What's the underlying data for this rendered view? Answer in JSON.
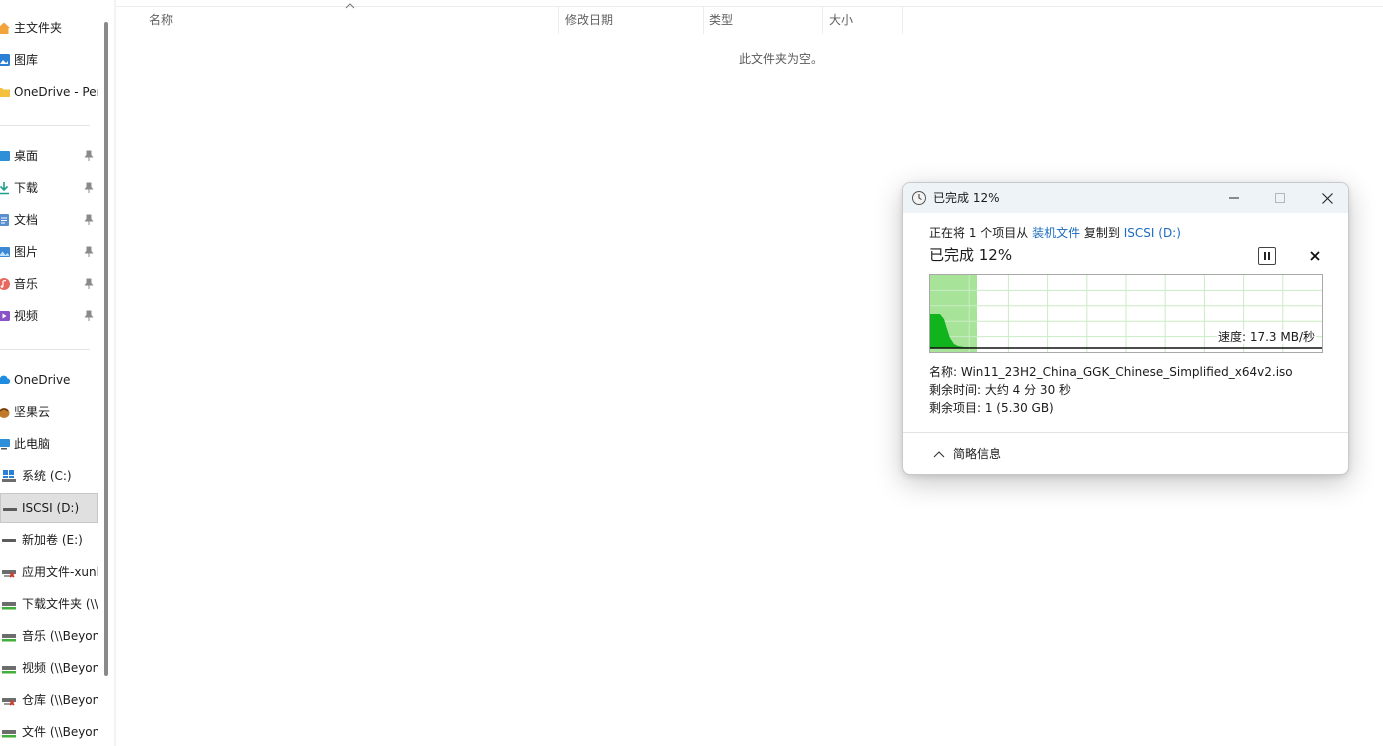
{
  "sidebar": {
    "items": [
      {
        "label": "主文件夹",
        "icon": "home-icon",
        "pinned": false
      },
      {
        "label": "图库",
        "icon": "gallery-icon",
        "pinned": false
      },
      {
        "label": "OneDrive - Personal",
        "icon": "folder-icon",
        "pinned": false
      },
      {
        "label": "桌面",
        "icon": "desktop-icon",
        "pinned": true
      },
      {
        "label": "下载",
        "icon": "download-icon",
        "pinned": true
      },
      {
        "label": "文档",
        "icon": "document-icon",
        "pinned": true
      },
      {
        "label": "图片",
        "icon": "pictures-icon",
        "pinned": true
      },
      {
        "label": "音乐",
        "icon": "music-icon",
        "pinned": true
      },
      {
        "label": "视频",
        "icon": "video-icon",
        "pinned": true
      },
      {
        "label": "OneDrive",
        "icon": "cloud-icon",
        "pinned": false
      },
      {
        "label": "坚果云",
        "icon": "nutstore-icon",
        "pinned": false
      },
      {
        "label": "此电脑",
        "icon": "computer-icon",
        "pinned": false
      },
      {
        "label": "系统 (C:)",
        "icon": "windows-drive-icon",
        "pinned": false
      },
      {
        "label": "ISCSI (D:)",
        "icon": "drive-icon",
        "pinned": false,
        "selected": true
      },
      {
        "label": "新加卷 (E:)",
        "icon": "drive-icon",
        "pinned": false
      },
      {
        "label": "应用文件-xunlei",
        "icon": "network-drive-disconnected-icon",
        "pinned": false
      },
      {
        "label": "下载文件夹 (\\\\Beyond",
        "icon": "network-drive-icon",
        "pinned": false
      },
      {
        "label": "音乐 (\\\\Beyond",
        "icon": "network-drive-icon",
        "pinned": false
      },
      {
        "label": "视频 (\\\\Beyond",
        "icon": "network-drive-icon",
        "pinned": false
      },
      {
        "label": "仓库 (\\\\Beyond",
        "icon": "network-drive-disconnected-icon",
        "pinned": false
      },
      {
        "label": "文件 (\\\\Beyond",
        "icon": "network-drive-icon",
        "pinned": false
      }
    ]
  },
  "file_list": {
    "columns": [
      "名称",
      "修改日期",
      "类型",
      "大小"
    ],
    "empty_message": "此文件夹为空。"
  },
  "copy_dialog": {
    "title": "已完成 12%",
    "desc_prefix": "正在将 1 个项目从 ",
    "source": "装机文件",
    "desc_middle": " 复制到 ",
    "destination": "ISCSI (D:)",
    "progress_title": "已完成 12%",
    "progress_percent": 12,
    "speed_label": "速度: 17.3 MB/秒",
    "name_line": "名称: Win11_23H2_China_GGK_Chinese_Simplified_x64v2.iso",
    "time_line": "剩余时间: 大约 4 分 30 秒",
    "items_line": "剩余项目: 1 (5.30 GB)",
    "details_toggle_label": "简略信息"
  },
  "colors": {
    "graph_fill_done": "#a8e39a",
    "graph_area": "#12b41e",
    "graph_grid": "#c9ecc4",
    "link": "#1a6bbf",
    "titlebar": "#edf3f7"
  }
}
